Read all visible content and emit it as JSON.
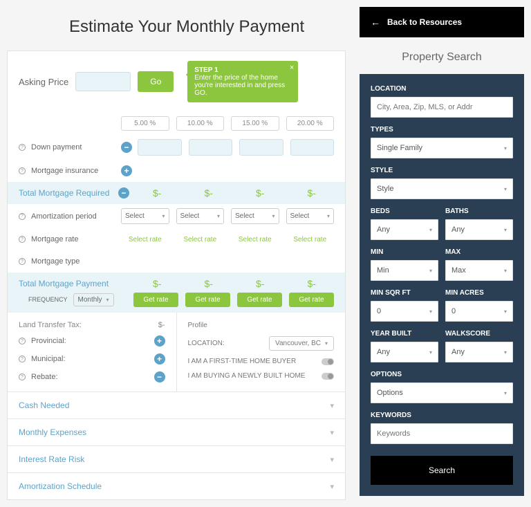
{
  "title": "Estimate Your Monthly Payment",
  "back": "Back to Resources",
  "searchTitle": "Property Search",
  "asking": {
    "label": "Asking Price",
    "go": "Go"
  },
  "tooltip": {
    "step": "STEP 1",
    "text": "Enter the price of the home you're interested in and press GO."
  },
  "labels": {
    "downPayment": "Down payment",
    "mortgageInsurance": "Mortgage insurance",
    "totalMortgageRequired": "Total Mortgage Required",
    "amortizationPeriod": "Amortization period",
    "mortgageRate": "Mortgage rate",
    "mortgageType": "Mortgage type",
    "totalMortgagePayment": "Total Mortgage Payment",
    "frequency": "FREQUENCY",
    "frequencyValue": "Monthly",
    "select": "Select",
    "selectRate": "Select rate",
    "getRate": "Get rate",
    "landTransferTax": "Land Transfer Tax:",
    "provincial": "Provincial:",
    "municipal": "Municipal:",
    "rebate": "Rebate:",
    "profile": "Profile",
    "location": "LOCATION:",
    "locationValue": "Vancouver, BC",
    "firstTime": "I AM A FIRST-TIME HOME BUYER",
    "newBuild": "I AM BUYING A NEWLY BUILT HOME"
  },
  "dash": "$-",
  "percents": [
    "5.00 %",
    "10.00 %",
    "15.00 %",
    "20.00 %"
  ],
  "accordion": [
    "Cash Needed",
    "Monthly Expenses",
    "Interest Rate Risk",
    "Amortization Schedule"
  ],
  "search": {
    "location": {
      "label": "LOCATION",
      "placeholder": "City, Area, Zip, MLS, or Addr"
    },
    "types": {
      "label": "TYPES",
      "value": "Single Family"
    },
    "style": {
      "label": "STYLE",
      "value": "Style"
    },
    "beds": {
      "label": "BEDS",
      "value": "Any"
    },
    "baths": {
      "label": "BATHS",
      "value": "Any"
    },
    "min": {
      "label": "MIN",
      "value": "Min"
    },
    "max": {
      "label": "MAX",
      "value": "Max"
    },
    "minSqft": {
      "label": "MIN SQR FT",
      "value": "0"
    },
    "minAcres": {
      "label": "MIN ACRES",
      "value": "0"
    },
    "yearBuilt": {
      "label": "YEAR BUILT",
      "value": "Any"
    },
    "walkscore": {
      "label": "WALKSCORE",
      "value": "Any"
    },
    "options": {
      "label": "OPTIONS",
      "value": "Options"
    },
    "keywords": {
      "label": "KEYWORDS",
      "placeholder": "Keywords"
    },
    "button": "Search"
  }
}
